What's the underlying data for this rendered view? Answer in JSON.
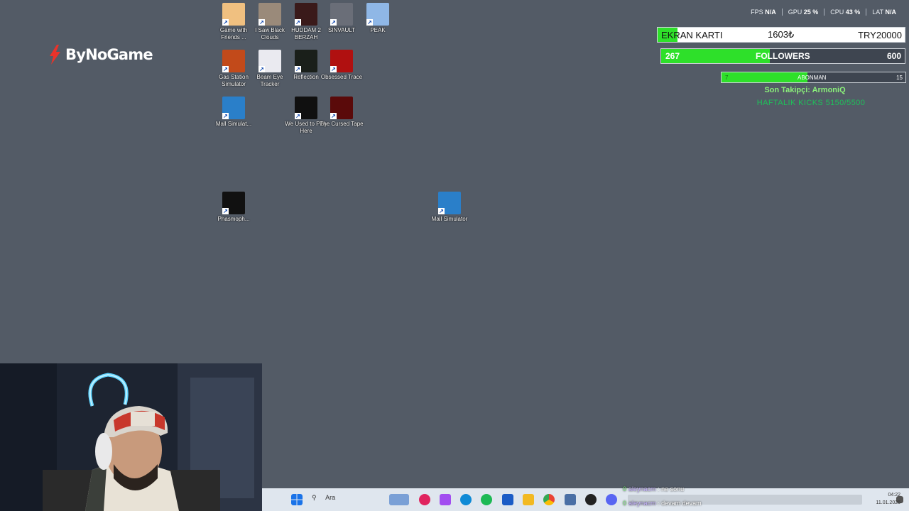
{
  "brand": {
    "name": "ByNoGame"
  },
  "desktop_icons": [
    {
      "label": "Game with Friends ...",
      "icon": "game-with-friends-icon",
      "color": "#f0c080"
    },
    {
      "label": "I Saw Black Clouds",
      "icon": "i-saw-black-clouds-icon",
      "color": "#9a8a7a"
    },
    {
      "label": "HUDDAM 2 BERZAH",
      "icon": "huddam-icon",
      "color": "#3a1a1a"
    },
    {
      "label": "SINVAULT",
      "icon": "sinvault-icon",
      "color": "#6a6e78"
    },
    {
      "label": "PEAK",
      "icon": "peak-icon",
      "color": "#8fb7e6"
    },
    {
      "label": "Gas Station Simulator",
      "icon": "gas-station-icon",
      "color": "#c24a1a"
    },
    {
      "label": "Beam Eye Tracker",
      "icon": "beam-eye-icon",
      "color": "#eaeaf0"
    },
    {
      "label": "Reflection",
      "icon": "reflection-icon",
      "color": "#1a1f1a"
    },
    {
      "label": "Obsessed Trace",
      "icon": "obsessed-trace-icon",
      "color": "#b01010"
    },
    {
      "label": "Mall Simulat...",
      "icon": "mall-simulator-icon",
      "color": "#2a7fc9"
    },
    {
      "label": "We Used to Play Here",
      "icon": "we-used-to-play-icon",
      "color": "#101010"
    },
    {
      "label": "The Cursed Tape",
      "icon": "cursed-tape-icon",
      "color": "#5a0a0a"
    },
    {
      "label": "Phasmoph...",
      "icon": "phasmophobia-icon",
      "color": "#111111"
    },
    {
      "label": "Mall Simulator",
      "icon": "mall-simulator-icon",
      "color": "#2a7fc9"
    }
  ],
  "perf": {
    "fps_label": "FPS",
    "fps": "N/A",
    "gpu_label": "GPU",
    "gpu": "25 %",
    "cpu_label": "CPU",
    "cpu": "43 %",
    "lat_label": "LAT",
    "lat": "N/A"
  },
  "overlay": {
    "ekran": {
      "title": "EKRAN KARTI",
      "current": "1603₺",
      "goal": "TRY20000",
      "progress": 0.08
    },
    "followers": {
      "current": "267",
      "label": "FOLLOWERS",
      "goal": "600",
      "progress": 0.445
    },
    "abonman": {
      "current": "7",
      "label": "ABONMAN",
      "goal": "15",
      "progress": 0.467
    },
    "son_takipci": "Son Takipçi: ArmoniQ",
    "haftalik": "HAFTALIK KICKS 5150/5500"
  },
  "taskbar": {
    "search_placeholder": "Ara",
    "time": "04:22",
    "date": "11.01.2026"
  },
  "chat": [
    {
      "n": "0",
      "user": "aleynacm",
      "sep": " : ",
      "msg": "ne sonu"
    },
    {
      "n": "0",
      "user": "aleynacm",
      "sep": " : ",
      "msg": "devam devam"
    }
  ],
  "colors": {
    "desktop": "#535b66",
    "progress_green": "#2ee02a",
    "haftalik_green": "#1fc05a"
  }
}
